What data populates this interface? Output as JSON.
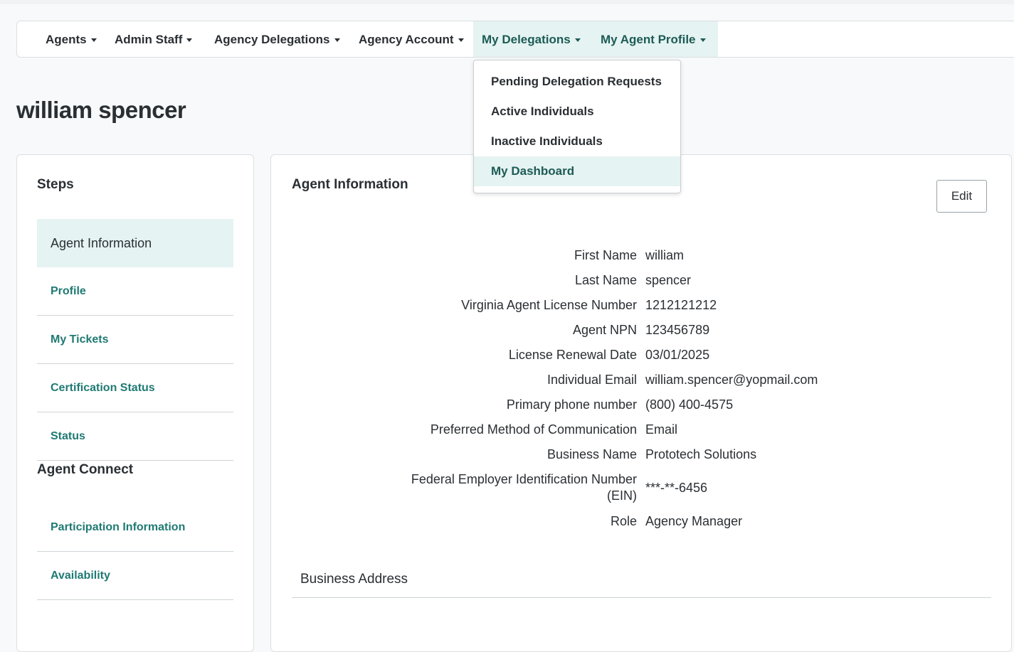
{
  "nav": {
    "items": [
      {
        "label": "Agents"
      },
      {
        "label": "Admin Staff"
      },
      {
        "label": "Agency Delegations"
      },
      {
        "label": "Agency Account"
      },
      {
        "label": "My Delegations"
      },
      {
        "label": "My Agent Profile"
      }
    ],
    "dropdown": [
      {
        "label": "Pending Delegation Requests"
      },
      {
        "label": "Active Individuals"
      },
      {
        "label": "Inactive Individuals"
      },
      {
        "label": "My Dashboard"
      }
    ]
  },
  "page": {
    "title": "william spencer"
  },
  "steps": {
    "heading": "Steps",
    "items": [
      {
        "label": "Agent Information"
      },
      {
        "label": "Profile"
      },
      {
        "label": "My Tickets"
      },
      {
        "label": "Certification Status"
      },
      {
        "label": "Status"
      }
    ],
    "connect_heading": "Agent Connect",
    "connect_items": [
      {
        "label": "Participation Information"
      },
      {
        "label": "Availability"
      }
    ]
  },
  "agent_info": {
    "heading": "Agent Information",
    "edit_label": "Edit",
    "fields": [
      {
        "label": "First Name",
        "value": "william"
      },
      {
        "label": "Last Name",
        "value": "spencer"
      },
      {
        "label": "Virginia Agent License Number",
        "value": "1212121212"
      },
      {
        "label": "Agent NPN",
        "value": "123456789"
      },
      {
        "label": "License Renewal Date",
        "value": "03/01/2025"
      },
      {
        "label": "Individual Email",
        "value": "william.spencer@yopmail.com"
      },
      {
        "label": "Primary phone number",
        "value": "(800) 400-4575"
      },
      {
        "label": "Preferred Method of Communication",
        "value": "Email"
      },
      {
        "label": "Business Name",
        "value": "Prototech Solutions"
      },
      {
        "label": "Federal Employer Identification Number (EIN)",
        "value": "***-**-6456"
      },
      {
        "label": "Role",
        "value": "Agency Manager"
      }
    ],
    "business_address_heading": "Business Address"
  },
  "colors": {
    "accent": "#1f7a73",
    "highlight": "#e5f3f2",
    "text": "#2a2f33"
  }
}
